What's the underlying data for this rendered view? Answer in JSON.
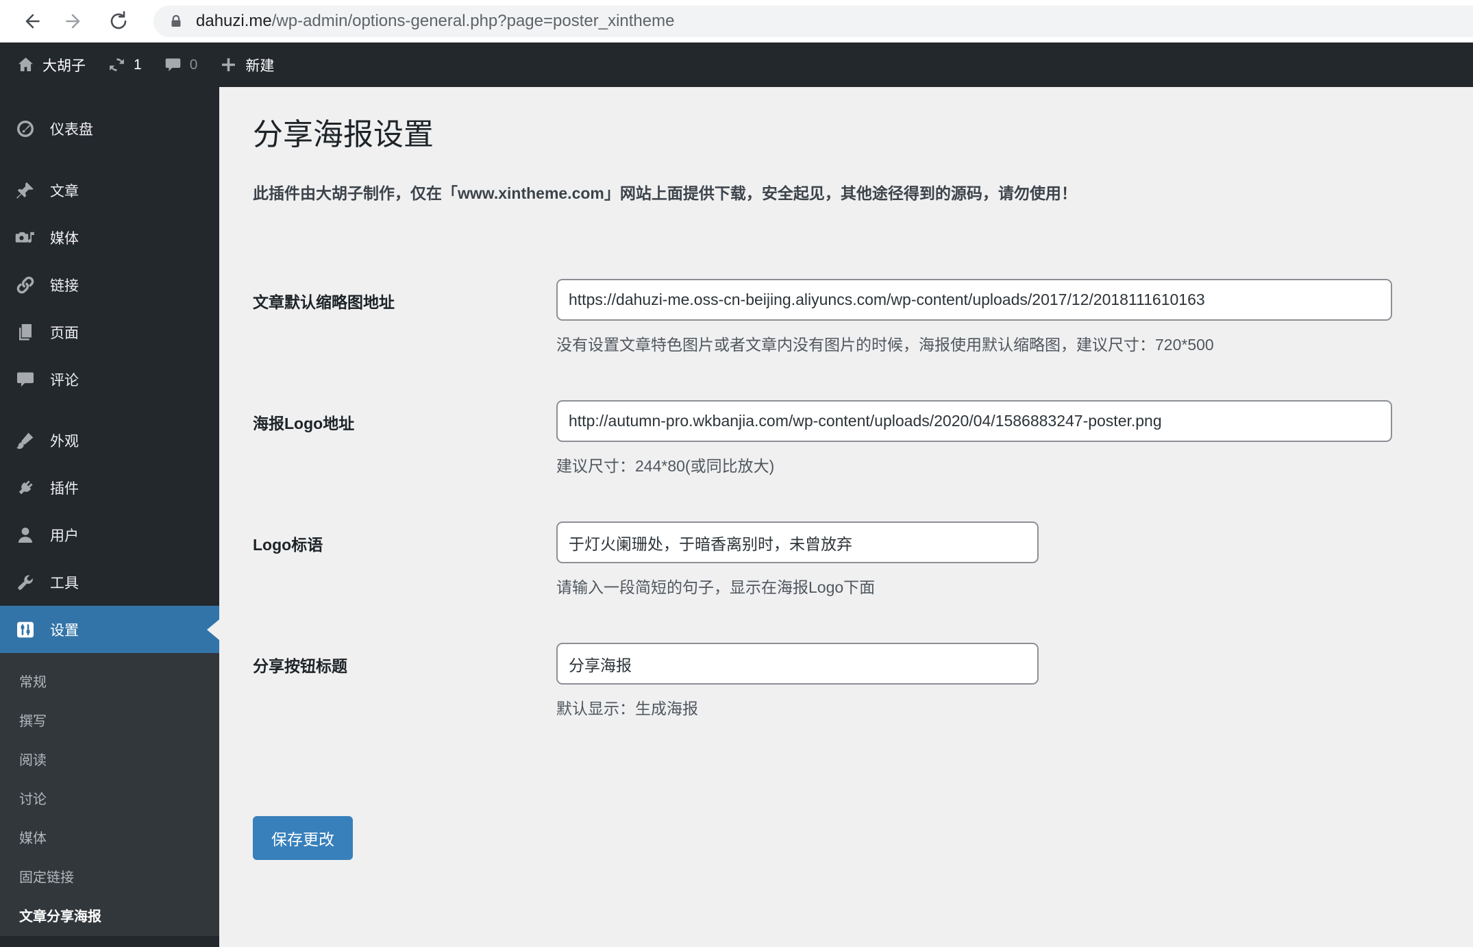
{
  "browser": {
    "url_main": "dahuzi.me",
    "url_path": "/wp-admin/options-general.php?page=poster_xintheme"
  },
  "admin_bar": {
    "site_name": "大胡子",
    "update_count": "1",
    "comment_count": "0",
    "new_label": "新建"
  },
  "sidebar": {
    "items": [
      {
        "label": "仪表盘",
        "icon": "gauge-icon"
      },
      {
        "label": "文章",
        "icon": "pin-icon"
      },
      {
        "label": "媒体",
        "icon": "media-icon"
      },
      {
        "label": "链接",
        "icon": "link-icon"
      },
      {
        "label": "页面",
        "icon": "pages-icon"
      },
      {
        "label": "评论",
        "icon": "comment-icon"
      },
      {
        "label": "外观",
        "icon": "brush-icon"
      },
      {
        "label": "插件",
        "icon": "plug-icon"
      },
      {
        "label": "用户",
        "icon": "user-icon"
      },
      {
        "label": "工具",
        "icon": "wrench-icon"
      },
      {
        "label": "设置",
        "icon": "settings-icon",
        "current": true
      }
    ],
    "submenu": [
      {
        "label": "常规"
      },
      {
        "label": "撰写"
      },
      {
        "label": "阅读"
      },
      {
        "label": "讨论"
      },
      {
        "label": "媒体"
      },
      {
        "label": "固定链接"
      },
      {
        "label": "文章分享海报",
        "current": true
      }
    ]
  },
  "page": {
    "title": "分享海报设置",
    "notice": "此插件由大胡子制作，仅在「www.xintheme.com」网站上面提供下载，安全起见，其他途径得到的源码，请勿使用！",
    "save_label": "保存更改"
  },
  "form": {
    "rows": [
      {
        "label": "文章默认缩略图地址",
        "value": "https://dahuzi-me.oss-cn-beijing.aliyuncs.com/wp-content/uploads/2017/12/2018111610163",
        "help": "没有设置文章特色图片或者文章内没有图片的时候，海报使用默认缩略图，建议尺寸：720*500"
      },
      {
        "label": "海报Logo地址",
        "value": "http://autumn-pro.wkbanjia.com/wp-content/uploads/2020/04/1586883247-poster.png",
        "help": "建议尺寸：244*80(或同比放大)"
      },
      {
        "label": "Logo标语",
        "value": "于灯火阑珊处，于暗香离别时，未曾放弃",
        "help": "请输入一段简短的句子，显示在海报Logo下面"
      },
      {
        "label": "分享按钮标题",
        "value": "分享海报",
        "help": "默认显示：生成海报"
      }
    ]
  },
  "colors": {
    "admin_bar_bg": "#23282d",
    "sidebar_bg": "#23282d",
    "submenu_bg": "#32373c",
    "menu_current_bg": "#3374a8",
    "content_bg": "#f0f0f1",
    "save_button_bg": "#3780bb"
  }
}
